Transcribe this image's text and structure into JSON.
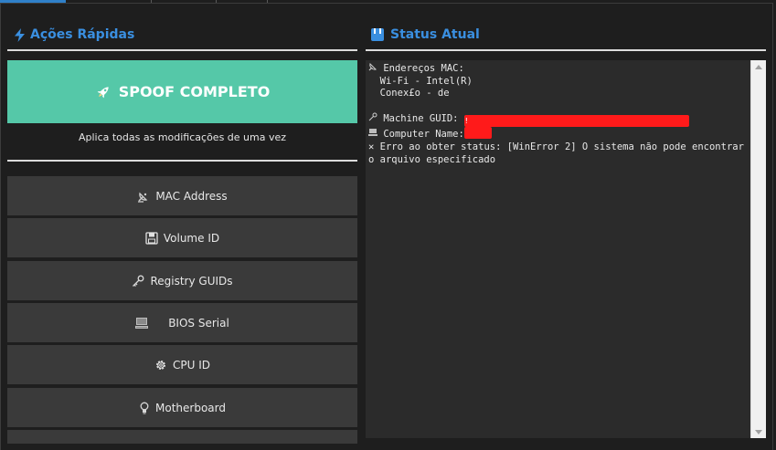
{
  "left_panel": {
    "title": "Ações Rápidas",
    "spoof_button_label": "SPOOF COMPLETO",
    "spoof_description": "Aplica todas as modificações de uma vez",
    "buttons": [
      {
        "label": "MAC Address",
        "icon": "satellite-dish-icon"
      },
      {
        "label": "Volume ID",
        "icon": "floppy-disk-icon"
      },
      {
        "label": "Registry GUIDs",
        "icon": "key-icon"
      },
      {
        "label": "BIOS Serial",
        "icon": "computer-icon"
      },
      {
        "label": "CPU ID",
        "icon": "gear-icon"
      },
      {
        "label": "Motherboard",
        "icon": "lightbulb-icon"
      }
    ]
  },
  "right_panel": {
    "title": "Status Atual",
    "lines": {
      "mac_header": "Endereços MAC:",
      "wifi": "Wi-Fi - Intel(R)",
      "conexao": "Conex£o - de",
      "guid_label": "Machine GUID:",
      "guid_value_prefix": "!",
      "computer_label": "Computer Name:",
      "error": "Erro ao obter status: [WinError 2] O sistema não pode encontrar o arquivo especificado"
    }
  },
  "colors": {
    "accent": "#3a8fe0",
    "spoof": "#55c8a8",
    "button_bg": "#3a3a3a",
    "redaction": "#ff1a1a"
  }
}
